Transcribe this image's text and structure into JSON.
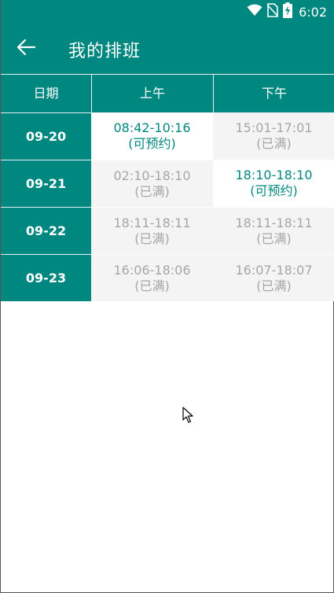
{
  "status_bar": {
    "time": "6:02",
    "icons": [
      "wifi-icon",
      "no-sim-icon",
      "battery-charging-icon"
    ]
  },
  "app_bar": {
    "back_icon": "arrow-left-icon",
    "title": "我的排班"
  },
  "colors": {
    "primary": "#00877f",
    "available_text": "#00877f",
    "full_text": "#a6a6a6",
    "full_bg": "#f4f4f4"
  },
  "schedule": {
    "headers": [
      "日期",
      "上午",
      "下午"
    ],
    "rows": [
      {
        "date": "09-20",
        "morning": {
          "time": "08:42-10:16",
          "status": "(可预约)",
          "available": true
        },
        "afternoon": {
          "time": "15:01-17:01",
          "status": "(已满)",
          "available": false
        }
      },
      {
        "date": "09-21",
        "morning": {
          "time": "02:10-18:10",
          "status": "(已满)",
          "available": false
        },
        "afternoon": {
          "time": "18:10-18:10",
          "status": "(可预约)",
          "available": true
        }
      },
      {
        "date": "09-22",
        "morning": {
          "time": "18:11-18:11",
          "status": "(已满)",
          "available": false
        },
        "afternoon": {
          "time": "18:11-18:11",
          "status": "(已满)",
          "available": false
        }
      },
      {
        "date": "09-23",
        "morning": {
          "time": "16:06-18:06",
          "status": "(已满)",
          "available": false
        },
        "afternoon": {
          "time": "16:07-18:07",
          "status": "(已满)",
          "available": false
        }
      }
    ]
  }
}
